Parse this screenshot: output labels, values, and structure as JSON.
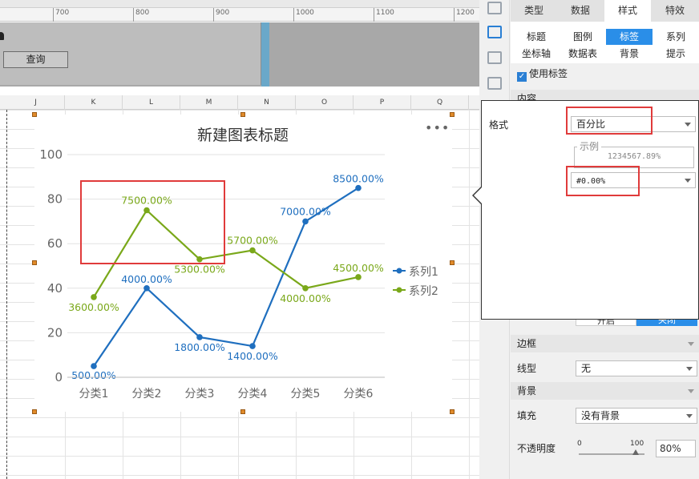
{
  "ruler": {
    "ticks": [
      "700",
      "800",
      "900",
      "1000",
      "1100",
      "1200"
    ]
  },
  "toolbar": {
    "query_label": "查询"
  },
  "sheet": {
    "columns": [
      "J",
      "K",
      "L",
      "M",
      "N",
      "O",
      "P",
      "Q"
    ]
  },
  "chart_data": {
    "type": "line",
    "title": "新建图表标题",
    "categories": [
      "分类1",
      "分类2",
      "分类3",
      "分类4",
      "分类5",
      "分类6"
    ],
    "series": [
      {
        "name": "系列1",
        "values": [
          5,
          40,
          18,
          14,
          70,
          85
        ],
        "labels": [
          "500.00%",
          "4000.00%",
          "1800.00%",
          "1400.00%",
          "7000.00%",
          "8500.00%"
        ],
        "color": "#1f6fbf"
      },
      {
        "name": "系列2",
        "values": [
          36,
          75,
          53,
          57,
          40,
          45
        ],
        "labels": [
          "3600.00%",
          "7500.00%",
          "5300.00%",
          "5700.00%",
          "4000.00%",
          "4500.00%"
        ],
        "color": "#7aa81a"
      }
    ],
    "yticks": [
      "0",
      "20",
      "40",
      "60",
      "80",
      "100"
    ],
    "ylim": [
      0,
      100
    ],
    "grid": true,
    "legend_position": "right"
  },
  "panel": {
    "tabs": [
      "类型",
      "数据",
      "样式",
      "特效"
    ],
    "active_tab": "样式",
    "subtabs": [
      "标题",
      "图例",
      "标签",
      "系列",
      "坐标轴",
      "数据表",
      "背景",
      "提示"
    ],
    "active_subtab": "标签",
    "use_label": "使用标签",
    "content_section": "内容",
    "toggle_on_text": "开启",
    "toggle_off_text": "关闭",
    "border_section": "边框",
    "line_type_label": "线型",
    "line_type_value": "无",
    "background_section": "背景",
    "fill_label": "填充",
    "fill_value": "没有背景",
    "opacity_label": "不透明度",
    "opacity_min": "0",
    "opacity_max": "100",
    "opacity_value": "80%"
  },
  "popup": {
    "format_label": "格式",
    "format_value": "百分比",
    "example_label": "示例",
    "example_value": "1234567.89%",
    "pattern_value": "#0.00%"
  },
  "colors": {
    "accent": "#2a8ee8",
    "highlight": "#e03b3b",
    "series1": "#1f6fbf",
    "series2": "#7aa81a"
  }
}
